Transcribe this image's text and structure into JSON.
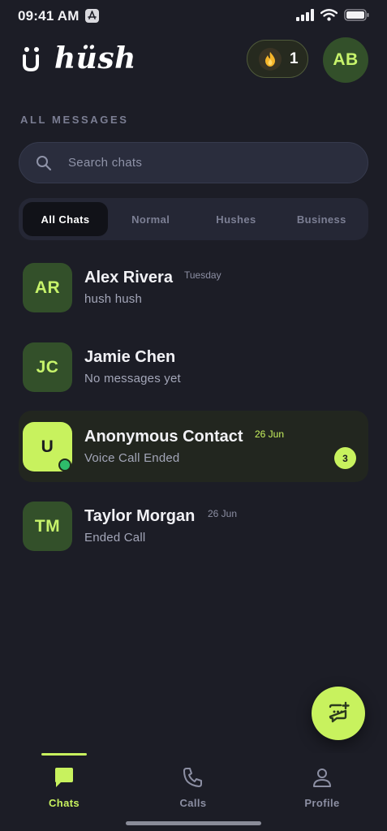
{
  "status_bar": {
    "time": "09:41 AM"
  },
  "header": {
    "brand": "hüsh",
    "coins": "1",
    "user_initials": "AB"
  },
  "section_label": "ALL MESSAGES",
  "search": {
    "placeholder": "Search chats"
  },
  "tabs": [
    {
      "label": "All Chats",
      "active": true
    },
    {
      "label": "Normal",
      "active": false
    },
    {
      "label": "Hushes",
      "active": false
    },
    {
      "label": "Business",
      "active": false
    }
  ],
  "chats": [
    {
      "initials": "AR",
      "name": "Alex Rivera",
      "time": "Tuesday",
      "preview": "hush hush"
    },
    {
      "initials": "JC",
      "name": "Jamie Chen",
      "time": "",
      "preview": "No messages yet"
    },
    {
      "initials": "U",
      "name": "Anonymous Contact",
      "time": "26 Jun",
      "preview": "Voice Call Ended",
      "unread": "3",
      "online": true
    },
    {
      "initials": "TM",
      "name": "Taylor Morgan",
      "time": "26 Jun",
      "preview": "Ended Call"
    }
  ],
  "nav": [
    {
      "label": "Chats",
      "icon": "chat-bubble-icon",
      "active": true
    },
    {
      "label": "Calls",
      "icon": "phone-icon",
      "active": false
    },
    {
      "label": "Profile",
      "icon": "person-icon",
      "active": false
    }
  ],
  "colors": {
    "accent": "#c8f25e",
    "background": "#1c1d26",
    "avatar_bg": "#33502a"
  }
}
